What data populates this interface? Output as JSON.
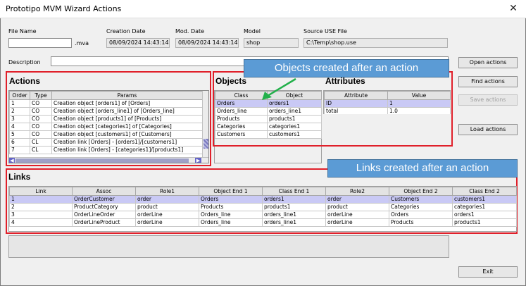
{
  "window": {
    "title": "Prototipo MVM Wizard Actions",
    "close": "✕"
  },
  "fields": {
    "file_name_label": "File Name",
    "file_name_value": "",
    "file_ext": ".mva",
    "creation_date_label": "Creation Date",
    "creation_date_value": "08/09/2024 14:43:14",
    "mod_date_label": "Mod. Date",
    "mod_date_value": "08/09/2024 14:43:14",
    "model_label": "Model",
    "model_value": "shop",
    "source_label": "Source USE File",
    "source_value": "C:\\Temp\\shop.use",
    "description_label": "Description",
    "description_value": ""
  },
  "buttons": {
    "open": "Open actions",
    "find": "Find actions",
    "save": "Save actions",
    "load": "Load actions",
    "exit": "Exit"
  },
  "actions": {
    "heading": "Actions",
    "columns": [
      "Order",
      "Type",
      "Params"
    ],
    "rows": [
      [
        "1",
        "CO",
        "Creation object [orders1] of [Orders]"
      ],
      [
        "2",
        "CO",
        "Creation object [orders_line1] of [Orders_line]"
      ],
      [
        "3",
        "CO",
        "Creation object [products1] of [Products]"
      ],
      [
        "4",
        "CO",
        "Creation object [categories1] of [Categories]"
      ],
      [
        "5",
        "CO",
        "Creation object [customers1] of [Customers]"
      ],
      [
        "6",
        "CL",
        "Creation link [Orders] - [orders1]/[customers1]"
      ],
      [
        "7",
        "CL",
        "Creation link [Orders] - [categories1]/[products1]"
      ]
    ]
  },
  "objects": {
    "heading": "Objects",
    "columns": [
      "Class",
      "Object"
    ],
    "rows": [
      [
        "Orders",
        "orders1"
      ],
      [
        "Orders_line",
        "orders_line1"
      ],
      [
        "Products",
        "products1"
      ],
      [
        "Categories",
        "categories1"
      ],
      [
        "Customers",
        "customers1"
      ]
    ]
  },
  "attributes": {
    "heading": "Attributes",
    "columns": [
      "Attribute",
      "Value"
    ],
    "rows": [
      [
        "ID",
        "1"
      ],
      [
        "total",
        "1.0"
      ]
    ]
  },
  "links": {
    "heading": "Links",
    "columns": [
      "Link",
      "Assoc",
      "Role1",
      "Object End 1",
      "Class End 1",
      "Role2",
      "Object End 2",
      "Class End 2"
    ],
    "rows": [
      [
        "1",
        "OrderCustomer",
        "order",
        "Orders",
        "orders1",
        "order",
        "Customers",
        "customers1"
      ],
      [
        "2",
        "ProductCategory",
        "product",
        "Products",
        "products1",
        "product",
        "Categories",
        "categories1"
      ],
      [
        "3",
        "OrderLineOrder",
        "orderLine",
        "Orders_line",
        "orders_line1",
        "orderLine",
        "Orders",
        "orders1"
      ],
      [
        "4",
        "OrderLineProduct",
        "orderLine",
        "Orders_line",
        "orders_line1",
        "orderLine",
        "Products",
        "products1"
      ]
    ]
  },
  "callouts": {
    "objects": "Objects created after an action",
    "links": "Links created after an action"
  },
  "colors": {
    "highlight_border": "#e0202a",
    "callout_bg": "#5b9bd5",
    "callout_arrow": "#22b04a",
    "selected_row": "#c9c9f5"
  }
}
